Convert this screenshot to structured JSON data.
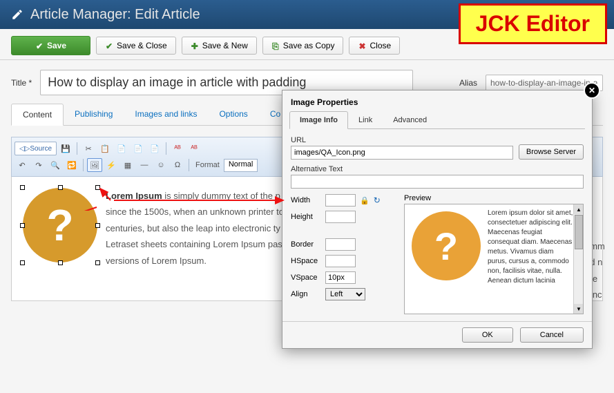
{
  "annotation": {
    "label": "JCK Editor"
  },
  "header": {
    "title": "Article Manager: Edit Article"
  },
  "actions": {
    "save": "Save",
    "save_close": "Save & Close",
    "save_new": "Save & New",
    "save_copy": "Save as Copy",
    "close": "Close"
  },
  "fields": {
    "title_label": "Title *",
    "title_value": "How to display an image in article with padding",
    "alias_label": "Alias",
    "alias_value": "how-to-display-an-image-in-articl"
  },
  "tabs": [
    "Content",
    "Publishing",
    "Images and links",
    "Options",
    "Co"
  ],
  "active_tab": 0,
  "editor_toolbar": {
    "source_label": "Source",
    "format_label": "Format",
    "format_value": "Normal"
  },
  "body": {
    "bold_lead": "Lorem Ipsum",
    "text": " is simply dummy text of the p\nsince the 1500s, when an unknown printer to\ncenturies, but also the leap into electronic ty\nLetraset sheets containing Lorem Ipsum pass\nversions of Lorem Ipsum."
  },
  "side_snippets": [
    "umm",
    "ed n",
    "the",
    "r inc"
  ],
  "dialog": {
    "title": "Image Properties",
    "close": "✕",
    "tabs": [
      "Image Info",
      "Link",
      "Advanced"
    ],
    "active_tab": 0,
    "url_label": "URL",
    "url_value": "images/QA_Icon.png",
    "browse": "Browse Server",
    "alt_label": "Alternative Text",
    "alt_value": "",
    "width_label": "Width",
    "width_value": "",
    "height_label": "Height",
    "height_value": "",
    "border_label": "Border",
    "border_value": "",
    "hspace_label": "HSpace",
    "hspace_value": "",
    "vspace_label": "VSpace",
    "vspace_value": "10px",
    "align_label": "Align",
    "align_value": "Left",
    "preview_label": "Preview",
    "preview_text": "Lorem ipsum dolor sit amet, consectetuer adipiscing elit. Maecenas feugiat consequat diam. Maecenas metus. Vivamus diam purus, cursus a, commodo non, facilisis vitae, nulla. Aenean dictum lacinia",
    "ok": "OK",
    "cancel": "Cancel"
  }
}
